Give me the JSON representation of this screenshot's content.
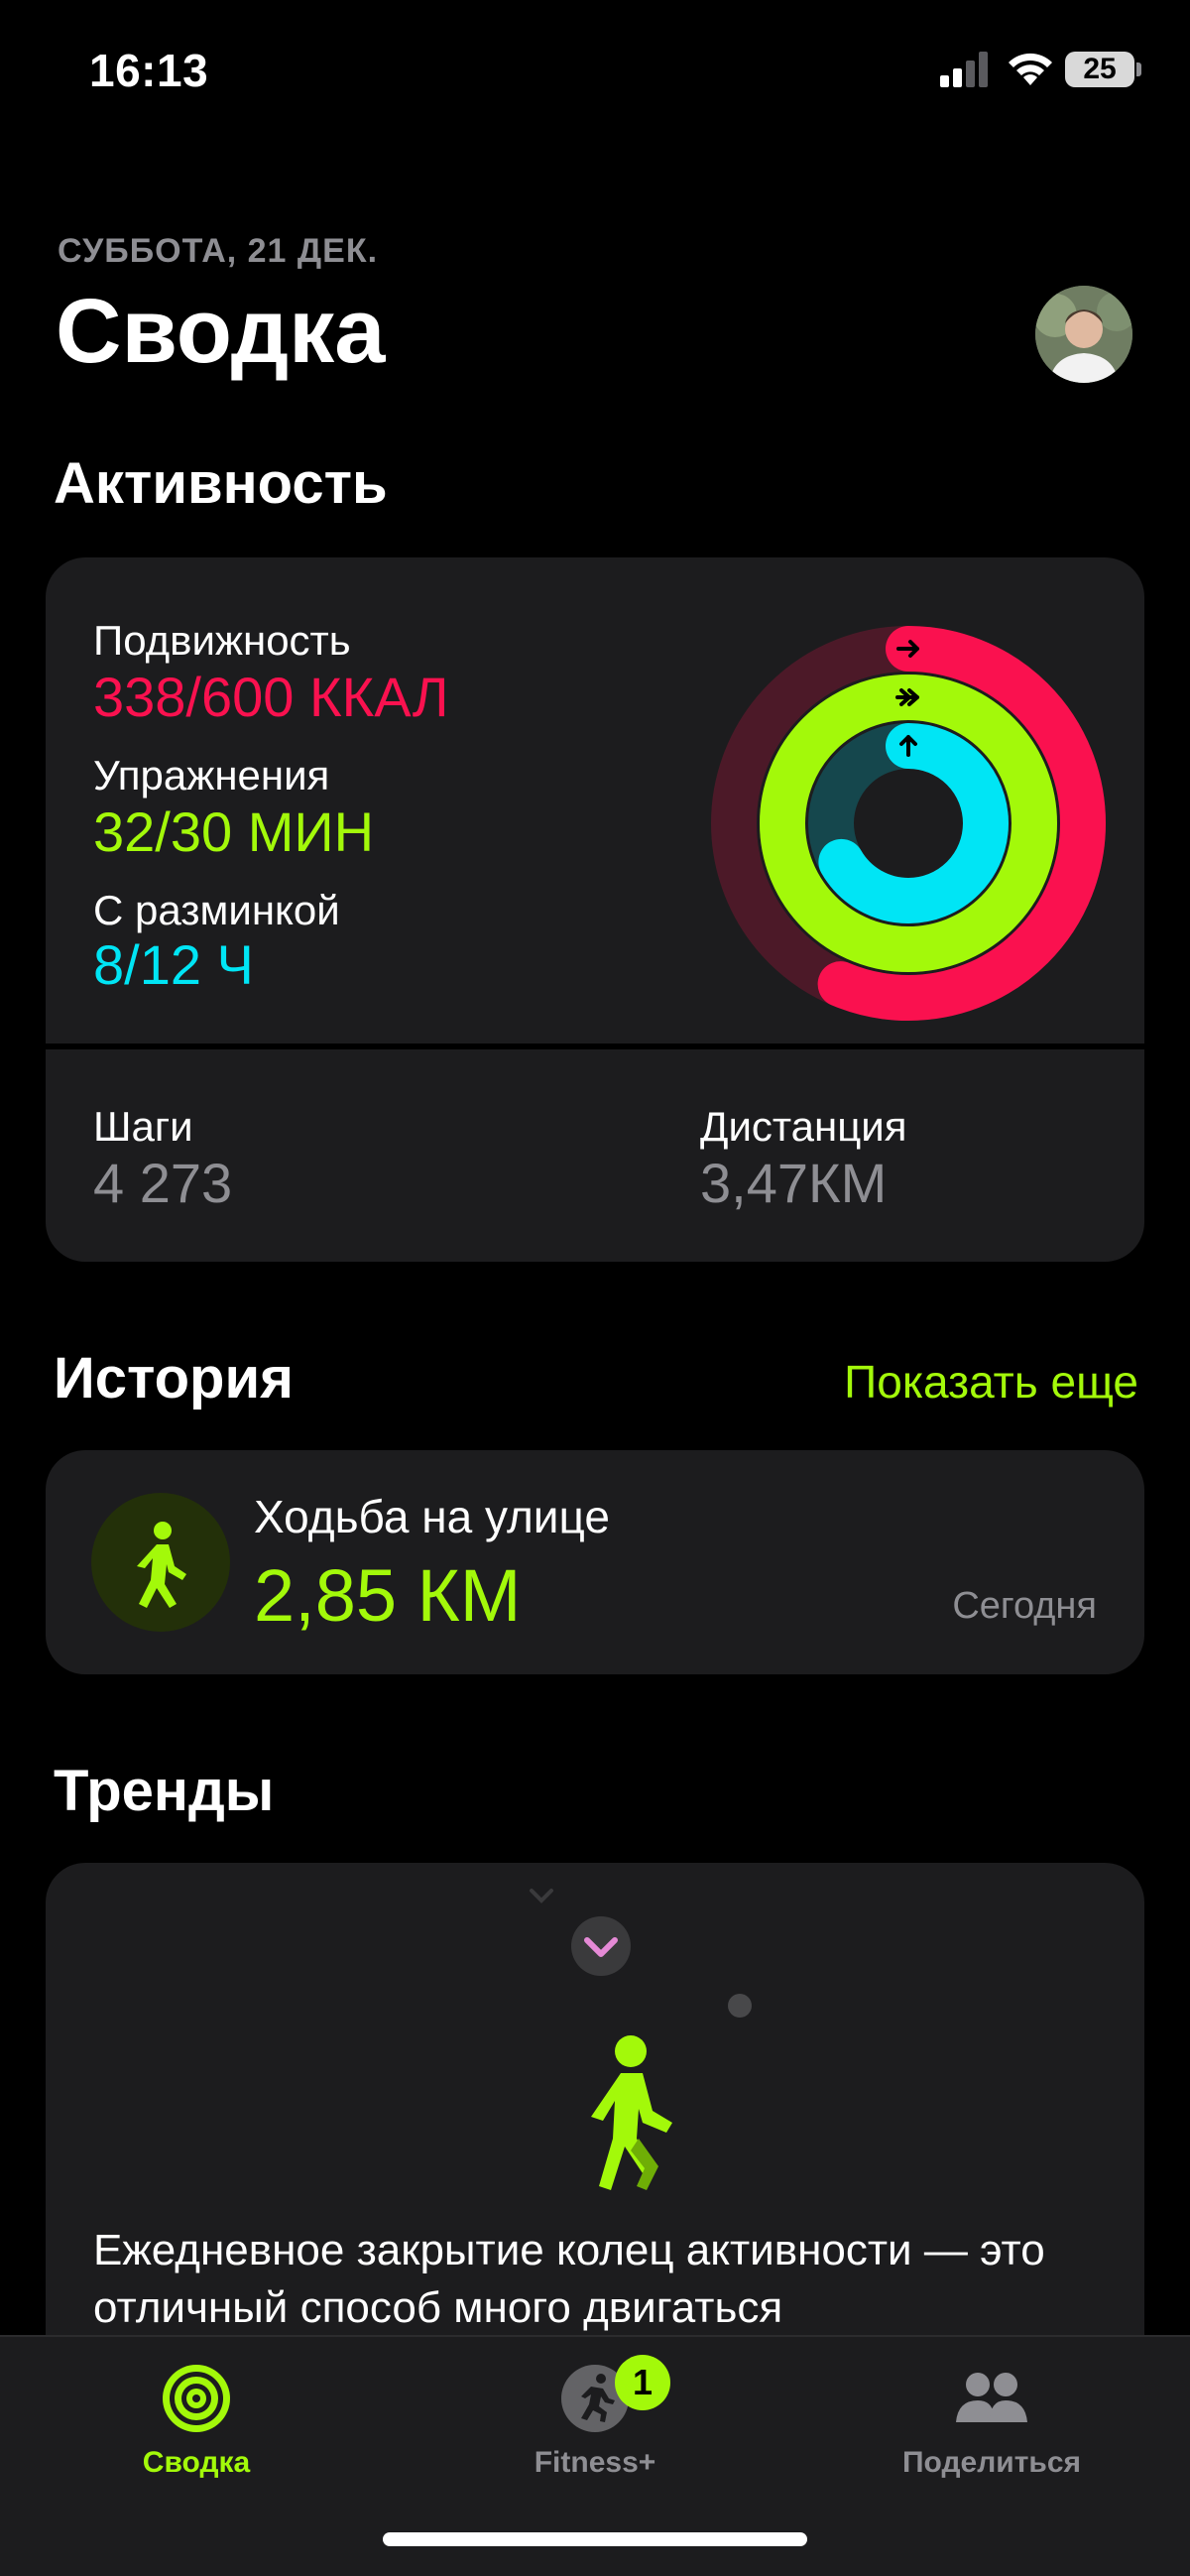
{
  "status_bar": {
    "time": "16:13",
    "battery": "25"
  },
  "header": {
    "date": "СУББОТА, 21 ДЕК.",
    "title": "Сводка"
  },
  "activity": {
    "section_title": "Активность",
    "move": {
      "label": "Подвижность",
      "value": "338/600 ККАЛ",
      "current": 338,
      "goal": 600,
      "color": "#fa114f"
    },
    "exercise": {
      "label": "Упражнения",
      "value": "32/30 МИН",
      "current": 32,
      "goal": 30,
      "color": "#a3f90a"
    },
    "stand": {
      "label": "С разминкой",
      "value": "8/12 Ч",
      "current": 8,
      "goal": 12,
      "color": "#00e5f5"
    },
    "steps": {
      "label": "Шаги",
      "value": "4 273"
    },
    "distance": {
      "label": "Дистанция",
      "value": "3,47КМ"
    }
  },
  "history": {
    "section_title": "История",
    "show_more": "Показать еще",
    "item": {
      "title": "Ходьба на улице",
      "value": "2,85 КМ",
      "date": "Сегодня",
      "icon": "walking-person-icon"
    }
  },
  "trends": {
    "section_title": "Тренды",
    "text": "Ежедневное закрытие колец активности — это отличный способ много двигаться"
  },
  "tabbar": {
    "tabs": [
      {
        "label": "Сводка",
        "icon": "activity-rings-icon",
        "active": true
      },
      {
        "label": "Fitness+",
        "icon": "running-person-icon",
        "active": false,
        "badge": "1"
      },
      {
        "label": "Поделиться",
        "icon": "people-icon",
        "active": false
      }
    ]
  },
  "colors": {
    "accent": "#a3f90a",
    "move": "#fa114f",
    "stand": "#00e5f5",
    "background": "#000000",
    "card": "#1c1c1e"
  }
}
